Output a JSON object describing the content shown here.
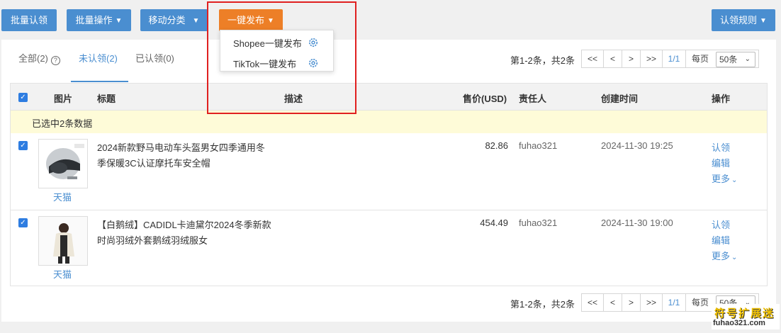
{
  "toolbar": {
    "batch_claim": "批量认领",
    "batch_ops": "批量操作",
    "move_category": "移动分类",
    "one_click_publish": "一键发布",
    "claim_rules": "认领规则"
  },
  "publish_menu": {
    "items": [
      {
        "label": "Shopee一键发布",
        "icon": "gear-icon"
      },
      {
        "label": "TikTok一键发布",
        "icon": "gear-icon"
      }
    ]
  },
  "tabs": [
    {
      "label": "全部(2)",
      "help_icon": "?"
    },
    {
      "label": "未认领(2)",
      "active": true
    },
    {
      "label": "已认领(0)"
    }
  ],
  "pagination": {
    "info": "第1-2条，共2条",
    "first": "<<",
    "prev": "<",
    "next": ">",
    "last": ">>",
    "current": "1/1",
    "per_page_label": "每页",
    "per_page_value": "50条"
  },
  "table": {
    "headers": {
      "image": "图片",
      "title": "标题",
      "description": "描述",
      "price": "售价(USD)",
      "owner": "责任人",
      "created": "创建时间",
      "actions": "操作"
    },
    "selection_text": "已选中2条数据",
    "rows": [
      {
        "shop": "天猫",
        "title_line1": "2024新款野马电动车头盔男女四季通用冬",
        "title_line2": "季保暖3C认证摩托车安全帽",
        "price": "82.86",
        "owner": "fuhao321",
        "created": "2024-11-30 19:25",
        "action_claim": "认领",
        "action_edit": "编辑",
        "action_more": "更多"
      },
      {
        "shop": "天猫",
        "title_line1": "【白鹅绒】CADIDL卡迪黛尔2024冬季新款",
        "title_line2": "时尚羽绒外套鹅绒羽绒服女",
        "price": "454.49",
        "owner": "fuhao321",
        "created": "2024-11-30 19:00",
        "action_claim": "认领",
        "action_edit": "编辑",
        "action_more": "更多"
      }
    ]
  },
  "watermark": {
    "line1": "符号扩展迷",
    "line2": "fuhao321.com"
  },
  "colors": {
    "primary_blue": "#4a8ed0",
    "orange": "#ed7f27",
    "highlight_red": "#e02020",
    "selection_bg": "#fefbd8"
  }
}
